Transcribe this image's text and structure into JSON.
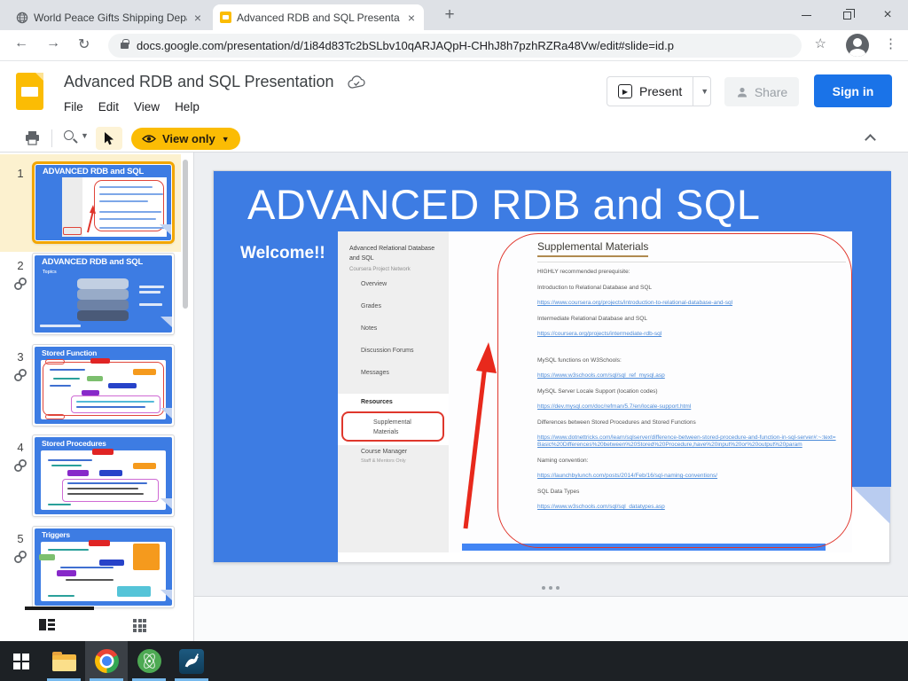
{
  "browser": {
    "tabs": [
      {
        "title": "World Peace Gifts Shipping Depa"
      },
      {
        "title": "Advanced RDB and SQL Presenta"
      }
    ],
    "url": "docs.google.com/presentation/d/1i84d83Tc2bSLbv10qARJAQpH-CHhJ8h7pzhRZRa48Vw/edit#slide=id.p"
  },
  "header": {
    "doc_title": "Advanced RDB and SQL Presentation",
    "menus": [
      "File",
      "Edit",
      "View",
      "Help"
    ],
    "present": "Present",
    "share": "Share",
    "sign_in": "Sign in"
  },
  "toolbar": {
    "view_only": "View only"
  },
  "thumbnails": [
    {
      "number": "1",
      "title": "ADVANCED RDB and SQL"
    },
    {
      "number": "2",
      "title": "ADVANCED RDB and SQL",
      "subtitle": "Topics"
    },
    {
      "number": "3",
      "title": "Stored Function"
    },
    {
      "number": "4",
      "title": "Stored Procedures"
    },
    {
      "number": "5",
      "title": "Triggers"
    }
  ],
  "slide": {
    "title": "ADVANCED RDB and SQL",
    "welcome": "Welcome!!",
    "course": {
      "sidebar_title": "Advanced Relational Database and SQL",
      "sidebar_org": "Coursera Project Network",
      "nav": [
        "Overview",
        "Grades",
        "Notes",
        "Discussion Forums",
        "Messages"
      ],
      "resources": "Resources",
      "selected": "Supplemental Materials",
      "manager": "Course Manager",
      "manager_sub": "Staff & Mentors Only",
      "heading": "Supplemental Materials",
      "lines": [
        {
          "type": "text",
          "text": "HIGHLY recommended prerequisite:"
        },
        {
          "type": "text",
          "text": "Introduction to Relational Database and SQL"
        },
        {
          "type": "link",
          "text": "https://www.coursera.org/projects/introduction-to-relational-database-and-sql"
        },
        {
          "type": "text",
          "text": "Intermediate Relational Database and SQL"
        },
        {
          "type": "link",
          "text": "https://coursera.org/projects/intermediate-rdb-sql"
        },
        {
          "type": "spacer",
          "text": ""
        },
        {
          "type": "text",
          "text": "MySQL functions on W3Schools:"
        },
        {
          "type": "link",
          "text": "https://www.w3schools.com/sql/sql_ref_mysql.asp"
        },
        {
          "type": "text",
          "text": "MySQL Server Locale Support (location codes)"
        },
        {
          "type": "link",
          "text": "https://dev.mysql.com/doc/refman/5.7/en/locale-support.html"
        },
        {
          "type": "text",
          "text": "Differences between Stored Procedures and Stored Functions"
        },
        {
          "type": "link",
          "text": "https://www.dotnettricks.com/learn/sqlserver/difference-between-stored-procedure-and-function-in-sql-server#:~:text=Basic%20Differences%20between%20Stored%20Procedure,have%20input%20or%20output%20param"
        },
        {
          "type": "text",
          "text": "Naming convention:"
        },
        {
          "type": "link",
          "text": "https://launchbylunch.com/posts/2014/Feb/16/sql-naming-conventions/"
        },
        {
          "type": "text",
          "text": "SQL Data Types"
        },
        {
          "type": "link",
          "text": "https://www.w3schools.com/sql/sql_datatypes.asp"
        }
      ]
    }
  },
  "colors": {
    "slide_blue": "#3d7ce3",
    "accent_blue": "#1a73e8",
    "yellow": "#fbbc04",
    "annotation_red": "#e0352b"
  },
  "taskbar": {
    "icons": [
      "windows-start",
      "file-explorer",
      "chrome",
      "green-atom-app",
      "mysql-workbench"
    ]
  }
}
